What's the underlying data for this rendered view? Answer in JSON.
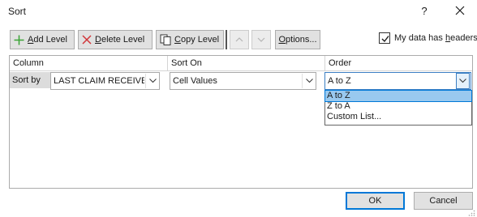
{
  "dialog": {
    "title": "Sort",
    "help_label": "?",
    "close_icon": "close-icon"
  },
  "toolbar": {
    "add_level": {
      "hotkey": "A",
      "rest": "dd Level",
      "icon": "plus-icon"
    },
    "delete_level": {
      "hotkey": "D",
      "rest": "elete Level",
      "icon": "x-icon"
    },
    "copy_level": {
      "hotkey": "C",
      "rest": "opy Level",
      "icon": "copy-icon"
    },
    "move_up_icon": "chevron-up-icon",
    "move_down_icon": "chevron-down-icon",
    "options": {
      "hotkey": "O",
      "rest": "ptions..."
    },
    "headers_checkbox": {
      "checked": true,
      "label_pre": "My data has ",
      "hotkey": "h",
      "label_post": "eaders"
    }
  },
  "grid": {
    "headers": {
      "column": "Column",
      "sort_on": "Sort On",
      "order": "Order"
    },
    "row": {
      "label": "Sort by",
      "column_value": "LAST CLAIM RECEIVED D",
      "sort_on_value": "Cell Values",
      "order_value": "A to Z"
    },
    "order_options": [
      "A to Z",
      "Z to A",
      "Custom List..."
    ],
    "selected_option": "A to Z"
  },
  "footer": {
    "ok": "OK",
    "cancel": "Cancel"
  },
  "colors": {
    "accent": "#0078d7",
    "selection": "#99c9ef",
    "plus_green": "#3aa335",
    "delete_red": "#d13438"
  }
}
